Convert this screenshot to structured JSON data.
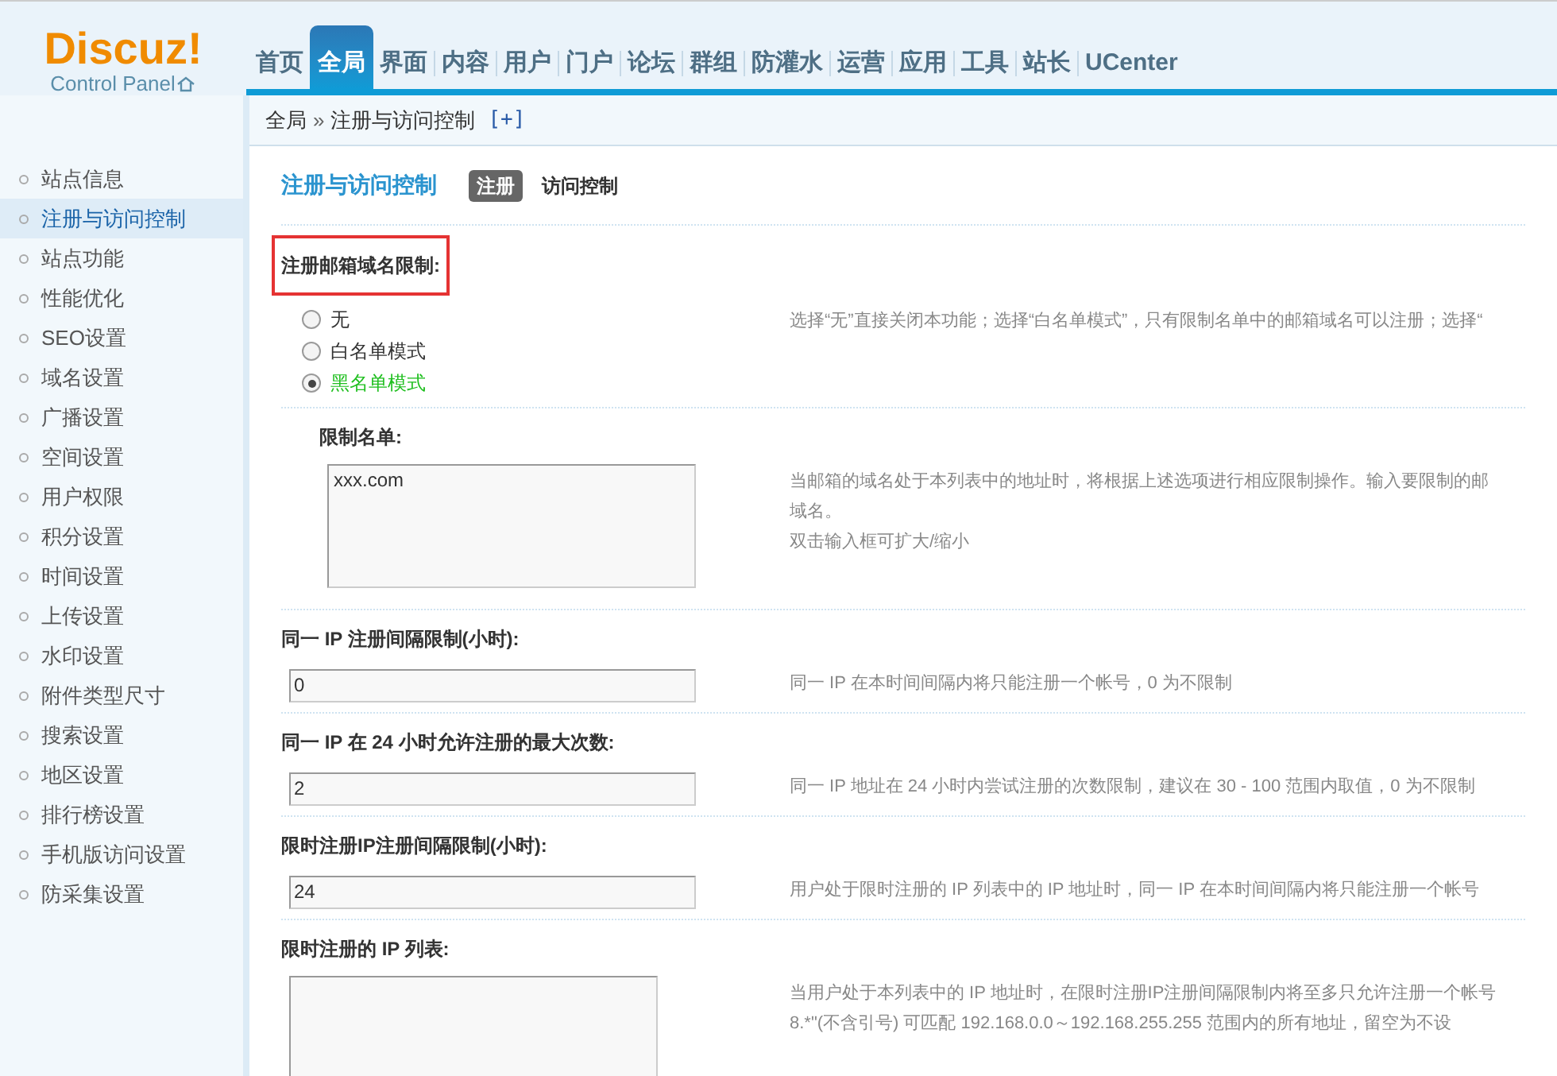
{
  "logo": {
    "name": "Discuz!",
    "subtitle": "Control Panel"
  },
  "nav": [
    {
      "label": "首页",
      "selected": false
    },
    {
      "label": "全局",
      "selected": true
    },
    {
      "label": "界面",
      "selected": false
    },
    {
      "label": "内容",
      "selected": false
    },
    {
      "label": "用户",
      "selected": false
    },
    {
      "label": "门户",
      "selected": false
    },
    {
      "label": "论坛",
      "selected": false
    },
    {
      "label": "群组",
      "selected": false
    },
    {
      "label": "防灌水",
      "selected": false
    },
    {
      "label": "运营",
      "selected": false
    },
    {
      "label": "应用",
      "selected": false
    },
    {
      "label": "工具",
      "selected": false
    },
    {
      "label": "站长",
      "selected": false
    },
    {
      "label": "UCenter",
      "selected": false
    }
  ],
  "breadcrumb": {
    "items": [
      "全局",
      "注册与访问控制"
    ],
    "separator": "»",
    "add": "[+]"
  },
  "sidebar": {
    "items": [
      {
        "label": "站点信息",
        "selected": false
      },
      {
        "label": "注册与访问控制",
        "selected": true
      },
      {
        "label": "站点功能",
        "selected": false
      },
      {
        "label": "性能优化",
        "selected": false
      },
      {
        "label": "SEO设置",
        "selected": false
      },
      {
        "label": "域名设置",
        "selected": false
      },
      {
        "label": "广播设置",
        "selected": false
      },
      {
        "label": "空间设置",
        "selected": false
      },
      {
        "label": "用户权限",
        "selected": false
      },
      {
        "label": "积分设置",
        "selected": false
      },
      {
        "label": "时间设置",
        "selected": false
      },
      {
        "label": "上传设置",
        "selected": false
      },
      {
        "label": "水印设置",
        "selected": false
      },
      {
        "label": "附件类型尺寸",
        "selected": false
      },
      {
        "label": "搜索设置",
        "selected": false
      },
      {
        "label": "地区设置",
        "selected": false
      },
      {
        "label": "排行榜设置",
        "selected": false
      },
      {
        "label": "手机版访问设置",
        "selected": false
      },
      {
        "label": "防采集设置",
        "selected": false
      }
    ]
  },
  "page": {
    "title": "注册与访问控制",
    "tabs": [
      {
        "label": "注册",
        "selected": true
      },
      {
        "label": "访问控制",
        "selected": false
      }
    ]
  },
  "settings": [
    {
      "kind": "radio",
      "label": "注册邮箱域名限制:",
      "highlighted": true,
      "options": [
        {
          "label": "无",
          "selected": false
        },
        {
          "label": "白名单模式",
          "selected": false
        },
        {
          "label": "黑名单模式",
          "selected": true
        }
      ],
      "description": [
        "选择“无”直接关闭本功能；选择“白名单模式”，只有限制名单中的邮箱域名可以注册；选择“"
      ]
    },
    {
      "kind": "textarea",
      "label": "限制名单:",
      "indented": true,
      "value": "xxx.com",
      "description": [
        "当邮箱的域名处于本列表中的地址时，将根据上述选项进行相应限制操作。输入要限制的邮",
        "域名。",
        "双击输入框可扩大/缩小"
      ]
    },
    {
      "kind": "input",
      "label": "同一 IP 注册间隔限制(小时):",
      "value": "0",
      "description": [
        "同一 IP 在本时间间隔内将只能注册一个帐号，0 为不限制"
      ]
    },
    {
      "kind": "input",
      "label": "同一 IP 在 24 小时允许注册的最大次数:",
      "value": "2",
      "description": [
        "同一 IP 地址在 24 小时内尝试注册的次数限制，建议在 30 - 100 范围内取值，0 为不限制"
      ]
    },
    {
      "kind": "input",
      "label": "限时注册IP注册间隔限制(小时):",
      "value": "24",
      "description": [
        "用户处于限时注册的 IP 列表中的 IP 地址时，同一 IP 在本时间间隔内将只能注册一个帐号"
      ]
    },
    {
      "kind": "textarea",
      "label": "限时注册的 IP 列表:",
      "description": [
        "当用户处于本列表中的 IP 地址时，在限时注册IP注册间隔限制内将至多只允许注册一个帐号",
        "8.*\"(不含引号) 可匹配 192.168.0.0～192.168.255.255 范围内的所有地址，留空为不设"
      ]
    }
  ]
}
